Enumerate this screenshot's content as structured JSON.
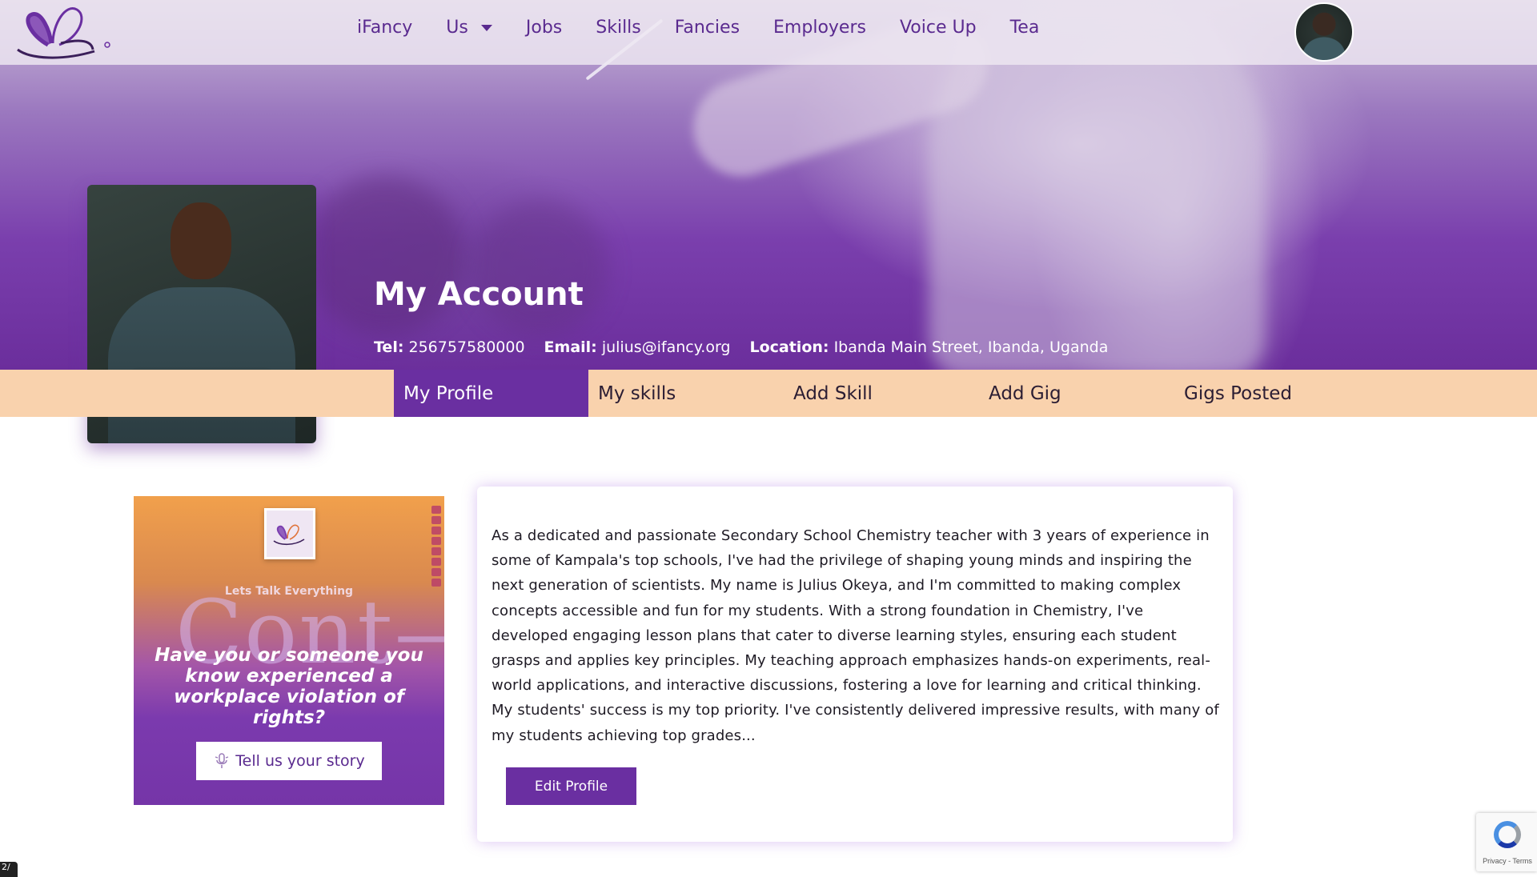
{
  "nav": {
    "items": [
      {
        "label": "iFancy"
      },
      {
        "label": "Us",
        "has_dropdown": true
      },
      {
        "label": "Jobs"
      },
      {
        "label": "Skills"
      },
      {
        "label": "Fancies"
      },
      {
        "label": "Employers"
      },
      {
        "label": "Voice Up"
      },
      {
        "label": "Tea"
      }
    ],
    "avatar_icon": "user-avatar-icon"
  },
  "account": {
    "title": "My Account",
    "tel_label": "Tel:",
    "tel_value": "256757580000",
    "email_label": "Email:",
    "email_value": "julius@ifancy.org",
    "location_label": "Location:",
    "location_value": "Ibanda Main Street, Ibanda, Uganda"
  },
  "tabs": [
    {
      "label": "My Profile",
      "active": true
    },
    {
      "label": "My skills",
      "active": false
    },
    {
      "label": "Add Skill",
      "active": false
    },
    {
      "label": "Add Gig",
      "active": false
    },
    {
      "label": "Gigs Posted",
      "active": false
    }
  ],
  "promo": {
    "tagline": "Lets Talk Everything",
    "big_text": "Cont—",
    "question": "Have you or someone you know experienced a workplace violation of rights?",
    "button_label": "Tell us your story"
  },
  "bio": {
    "text": "As a dedicated and passionate Secondary School Chemistry teacher with 3 years of experience in some of Kampala's top schools, I've had the privilege of shaping young minds and inspiring the next generation of scientists. My name is Julius Okeya, and I'm committed to making complex concepts accessible and fun for my students. With a strong foundation in Chemistry, I've developed engaging lesson plans that cater to diverse learning styles, ensuring each student grasps and applies key principles. My teaching approach emphasizes hands-on experiments, real-world applications, and interactive discussions, fostering a love for learning and critical thinking. My students' success is my top priority. I've consistently delivered impressive results, with many of my students achieving top grades...",
    "edit_button": "Edit Profile"
  },
  "recaptcha": {
    "text": "Privacy - Terms"
  },
  "corner_badge": "2/",
  "colors": {
    "brand_purple": "#6a2fa1",
    "nav_text": "#5a2a8f",
    "tab_bar": "#f9d2ad",
    "promo_orange": "#f1a04c"
  }
}
